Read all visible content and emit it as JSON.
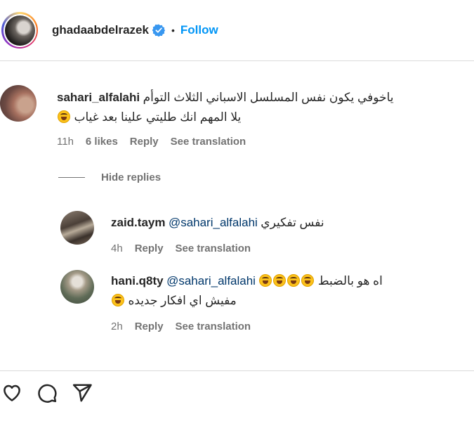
{
  "post_header": {
    "username": "ghadaabdelrazek",
    "separator": "•",
    "follow_label": "Follow",
    "verified_color": "#3897f0"
  },
  "main_comment": {
    "username": "sahari_alfalahi",
    "text_line1": "ياخوفي يكون نفس المسلسل الاسباني الثلاث التوأم",
    "text_line2": "يلا المهم انك طليتي علينا بعد غياب",
    "emoji": "grinning-sweat-emoji",
    "time": "11h",
    "likes": "6 likes",
    "reply_label": "Reply",
    "translate_label": "See translation"
  },
  "hide_replies_label": "Hide replies",
  "replies": [
    {
      "username": "zaid.taym",
      "mention": "@sahari_alfalahi",
      "text": "نفس تفكيري",
      "time": "4h",
      "reply_label": "Reply",
      "translate_label": "See translation"
    },
    {
      "username": "hani.q8ty",
      "mention": "@sahari_alfalahi",
      "text_line1": "اه هو بالضبط",
      "text_line2": "مفيش اي افكار جديده",
      "emoji": "tears-of-joy-emoji",
      "time": "2h",
      "reply_label": "Reply",
      "translate_label": "See translation"
    }
  ],
  "actions": {
    "icons": [
      "heart-icon",
      "comment-icon",
      "share-icon"
    ]
  },
  "colors": {
    "link_blue": "#0095f6",
    "mention_blue": "#00376b",
    "meta_gray": "#737373",
    "divider": "#dbdbdb"
  }
}
